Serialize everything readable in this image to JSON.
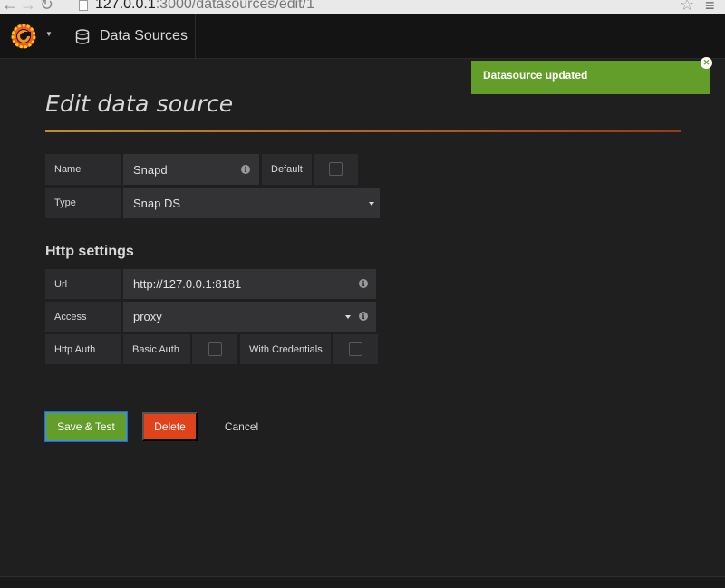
{
  "browser": {
    "url_host": "127.0.0.1",
    "url_path": ":3000/datasources/edit/1"
  },
  "topnav": {
    "page_label": "Data Sources"
  },
  "toast": {
    "message": "Datasource updated",
    "color": "#629e29"
  },
  "page": {
    "title": "Edit data source"
  },
  "form": {
    "name_label": "Name",
    "name_value": "Snapd",
    "default_label": "Default",
    "default_checked": false,
    "type_label": "Type",
    "type_value": "Snap DS"
  },
  "http": {
    "section_title": "Http settings",
    "url_label": "Url",
    "url_value": "http://127.0.0.1:8181",
    "access_label": "Access",
    "access_value": "proxy",
    "auth_label": "Http Auth",
    "basic_auth_label": "Basic Auth",
    "basic_auth_checked": false,
    "with_credentials_label": "With Credentials",
    "with_credentials_checked": false
  },
  "actions": {
    "save_label": "Save & Test",
    "delete_label": "Delete",
    "cancel_label": "Cancel"
  },
  "icons": {
    "logo": "grafana-logo",
    "datasource": "database-icon",
    "info": "info-icon",
    "close": "close-icon",
    "dropdown": "caret-down-icon"
  }
}
